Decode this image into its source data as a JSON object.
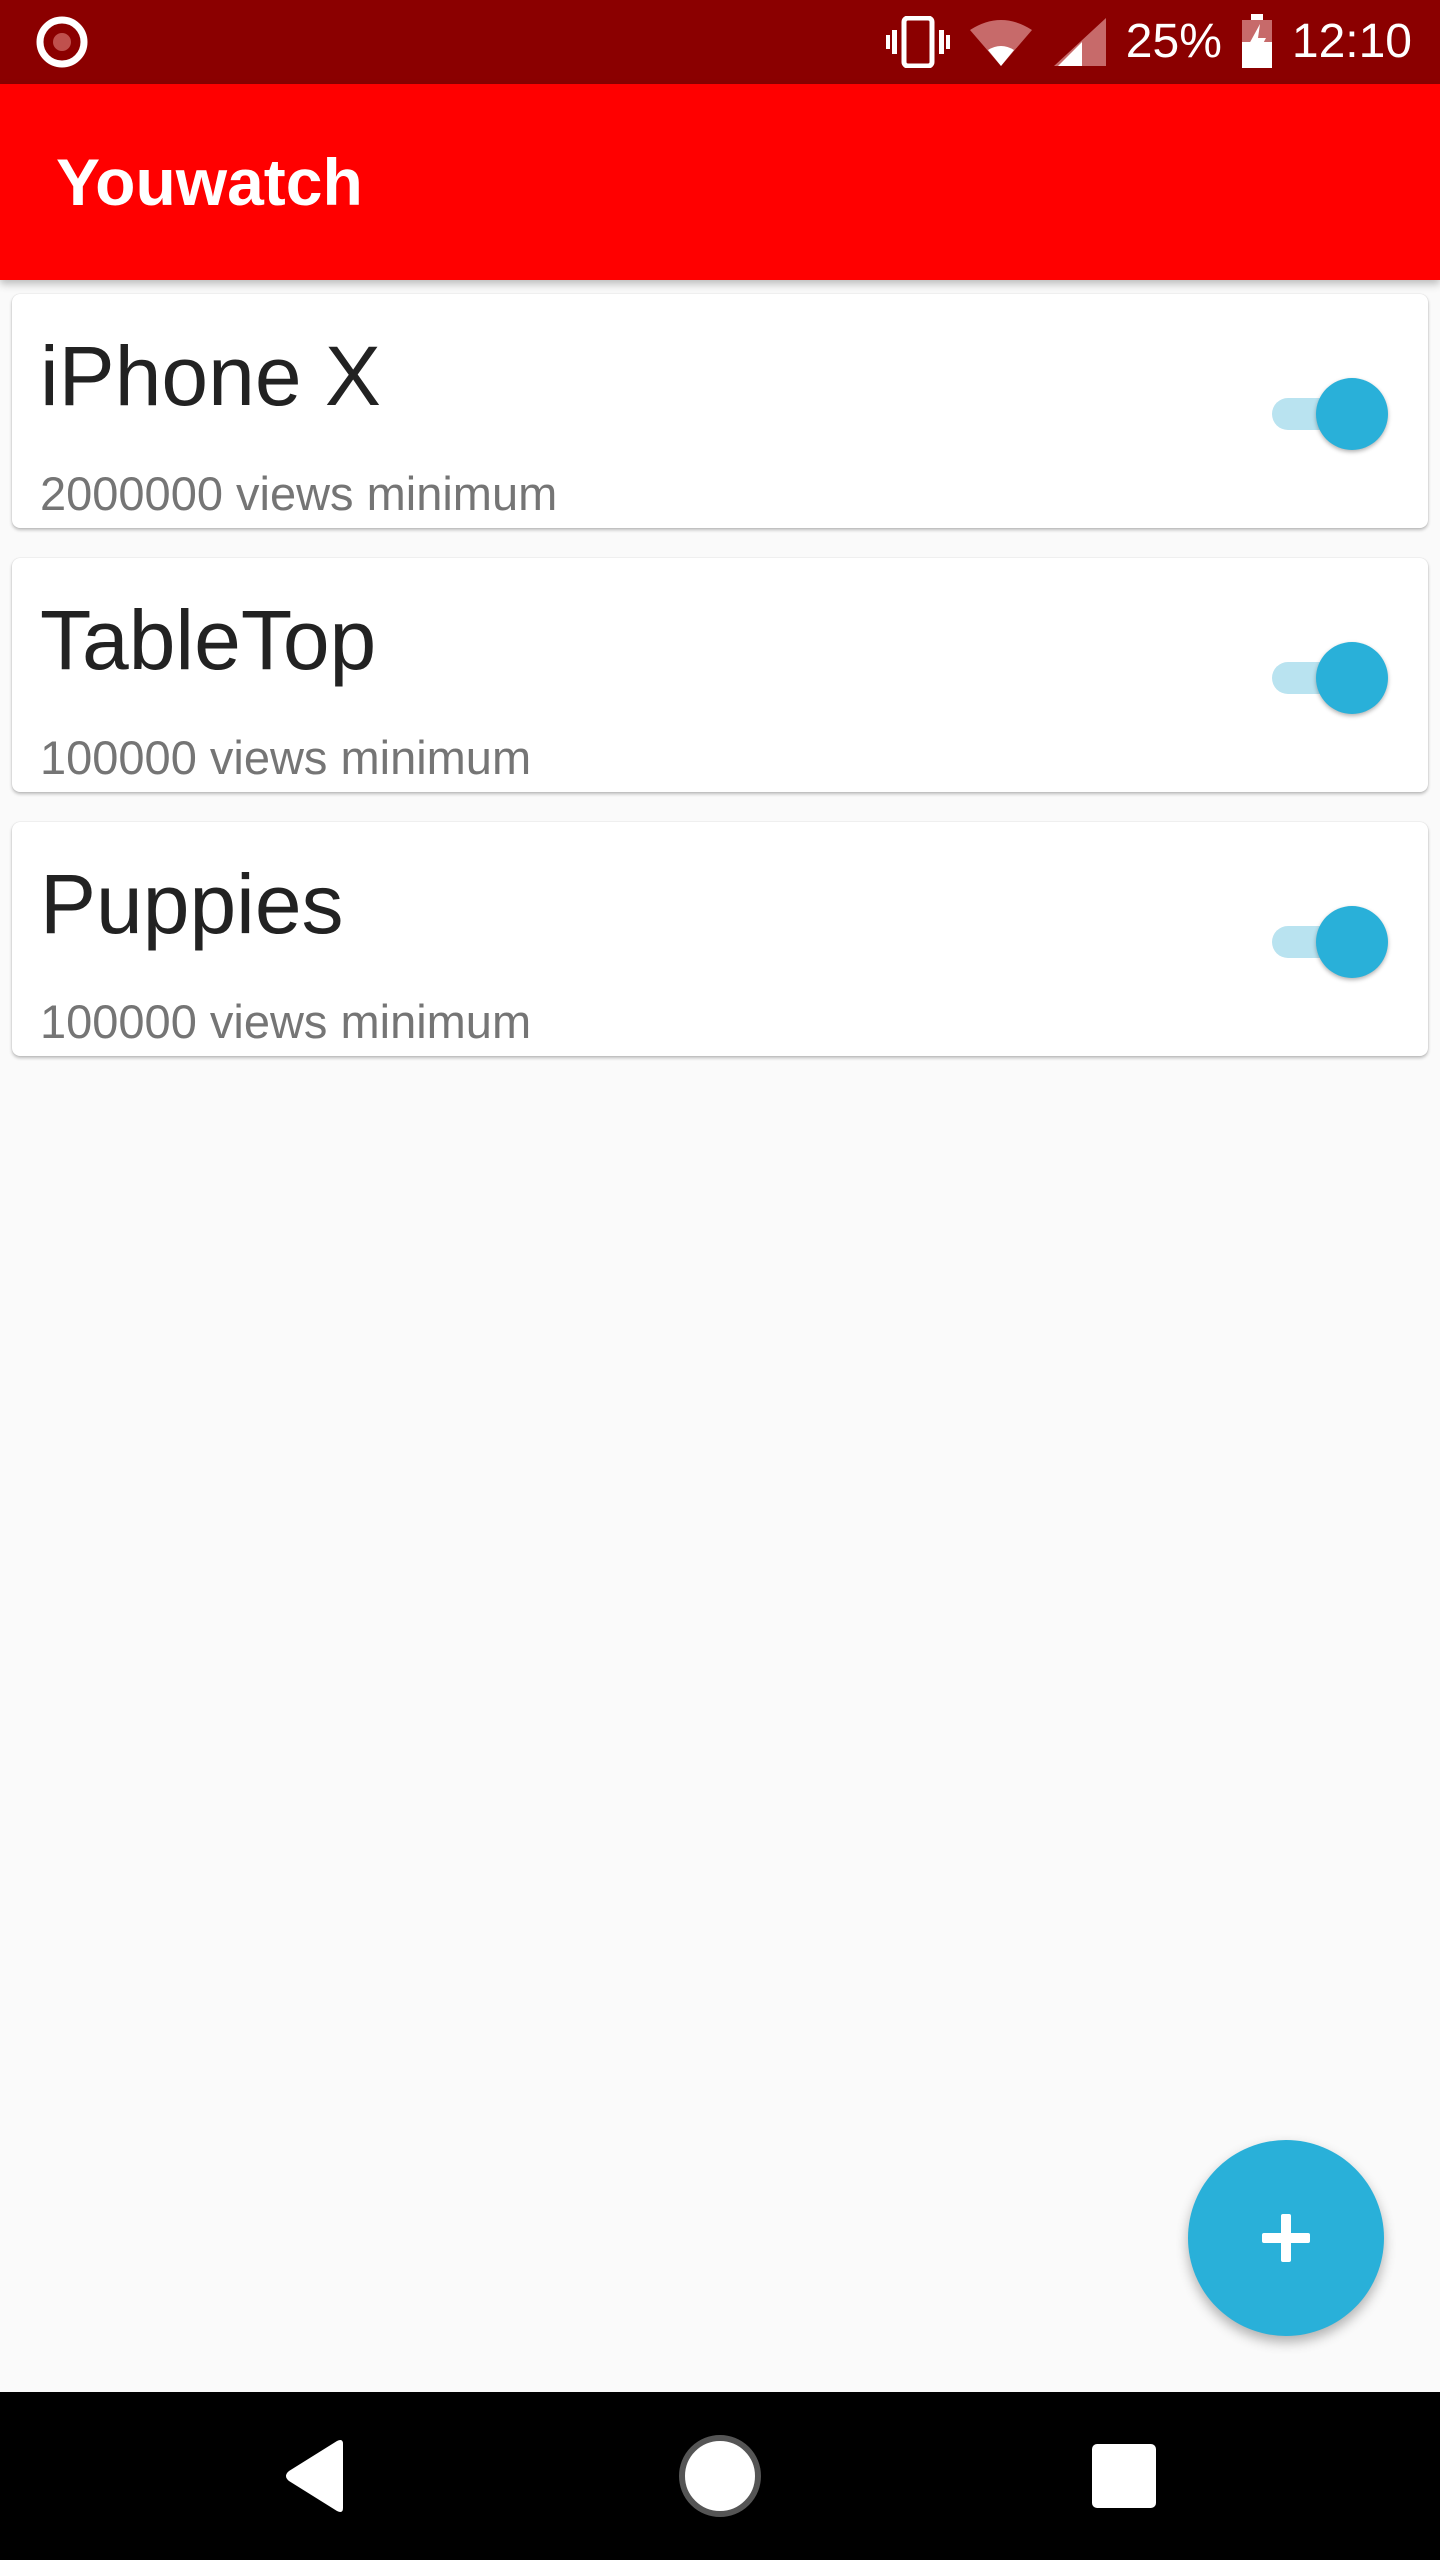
{
  "status_bar": {
    "battery": "25%",
    "time": "12:10",
    "icons": [
      "record-icon",
      "vibrate-icon",
      "wifi-icon",
      "cell-signal-icon",
      "battery-charging-icon"
    ]
  },
  "app_bar": {
    "title": "Youwatch"
  },
  "list": {
    "items": [
      {
        "title": "iPhone X",
        "subtitle": "2000000 views minimum",
        "enabled": true
      },
      {
        "title": "TableTop",
        "subtitle": "100000 views minimum",
        "enabled": true
      },
      {
        "title": "Puppies",
        "subtitle": "100000 views minimum",
        "enabled": true
      }
    ]
  },
  "fab": {
    "icon": "plus-icon"
  },
  "nav_bar": {
    "icons": [
      "back-icon",
      "home-icon",
      "recents-icon"
    ]
  },
  "colors": {
    "status_bar": "#8b0000",
    "app_bar": "#ff0000",
    "accent": "#29b0d9",
    "switch_track": "#b9e3f0",
    "background": "#fafafa"
  }
}
